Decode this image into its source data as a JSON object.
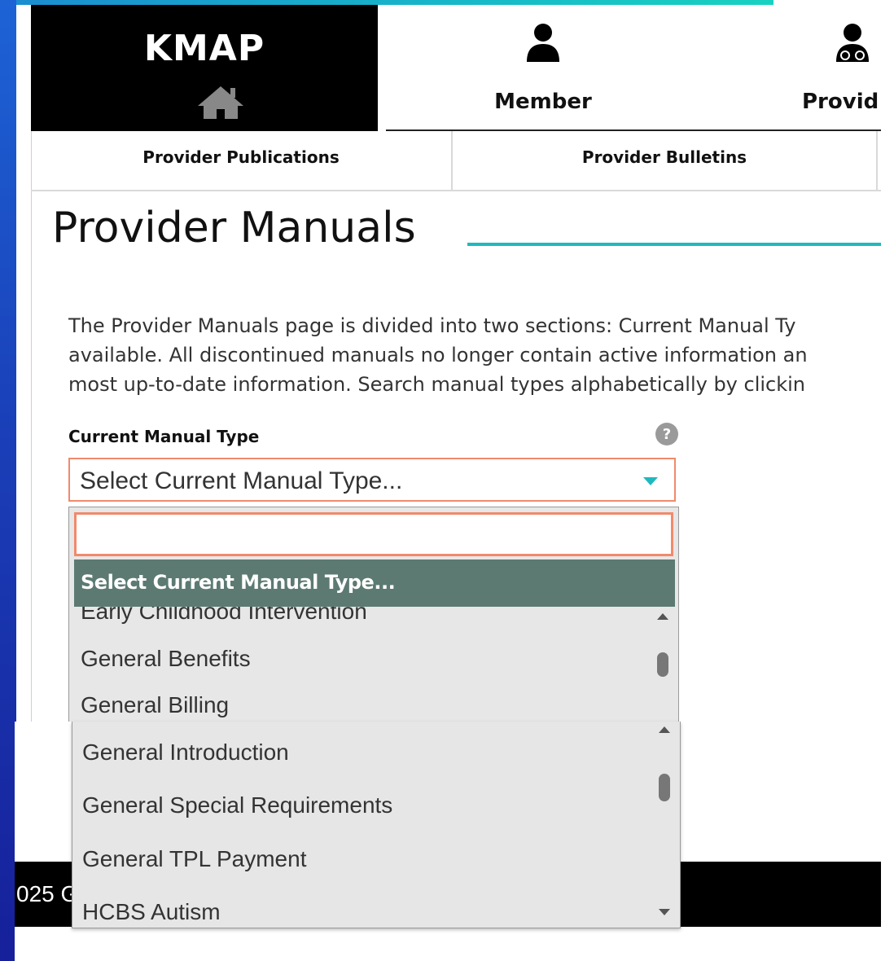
{
  "header": {
    "logo_text": "KMAP",
    "nav": [
      {
        "label": "Member",
        "icon": "person-icon"
      },
      {
        "label": "Provid",
        "icon": "doctor-icon"
      }
    ]
  },
  "subtabs": [
    "Provider Publications",
    "Provider Bulletins"
  ],
  "page": {
    "title": "Provider Manuals",
    "intro_lines": [
      "The Provider Manuals page is divided into two sections: Current Manual Ty",
      "available. All discontinued manuals no longer contain active information an",
      "most up-to-date information. Search manual types alphabetically by clickin"
    ]
  },
  "current_manual": {
    "label": "Current Manual Type",
    "selected": "Select Current Manual Type...",
    "search_value": "",
    "dropdown_header": "Select Current Manual Type...",
    "options_first": [
      "Early Childhood Intervention",
      "General Benefits",
      "General Billing"
    ],
    "options_second": [
      "General Introduction",
      "General Special Requirements",
      "General TPL Payment",
      "HCBS Autism"
    ]
  },
  "footer": {
    "text": "025 G"
  },
  "colors": {
    "accent_teal": "#1fb9bd",
    "select_border": "#f08a6b",
    "dropdown_header_bg": "#5c7a72",
    "left_bar": "#1a3fb8"
  }
}
